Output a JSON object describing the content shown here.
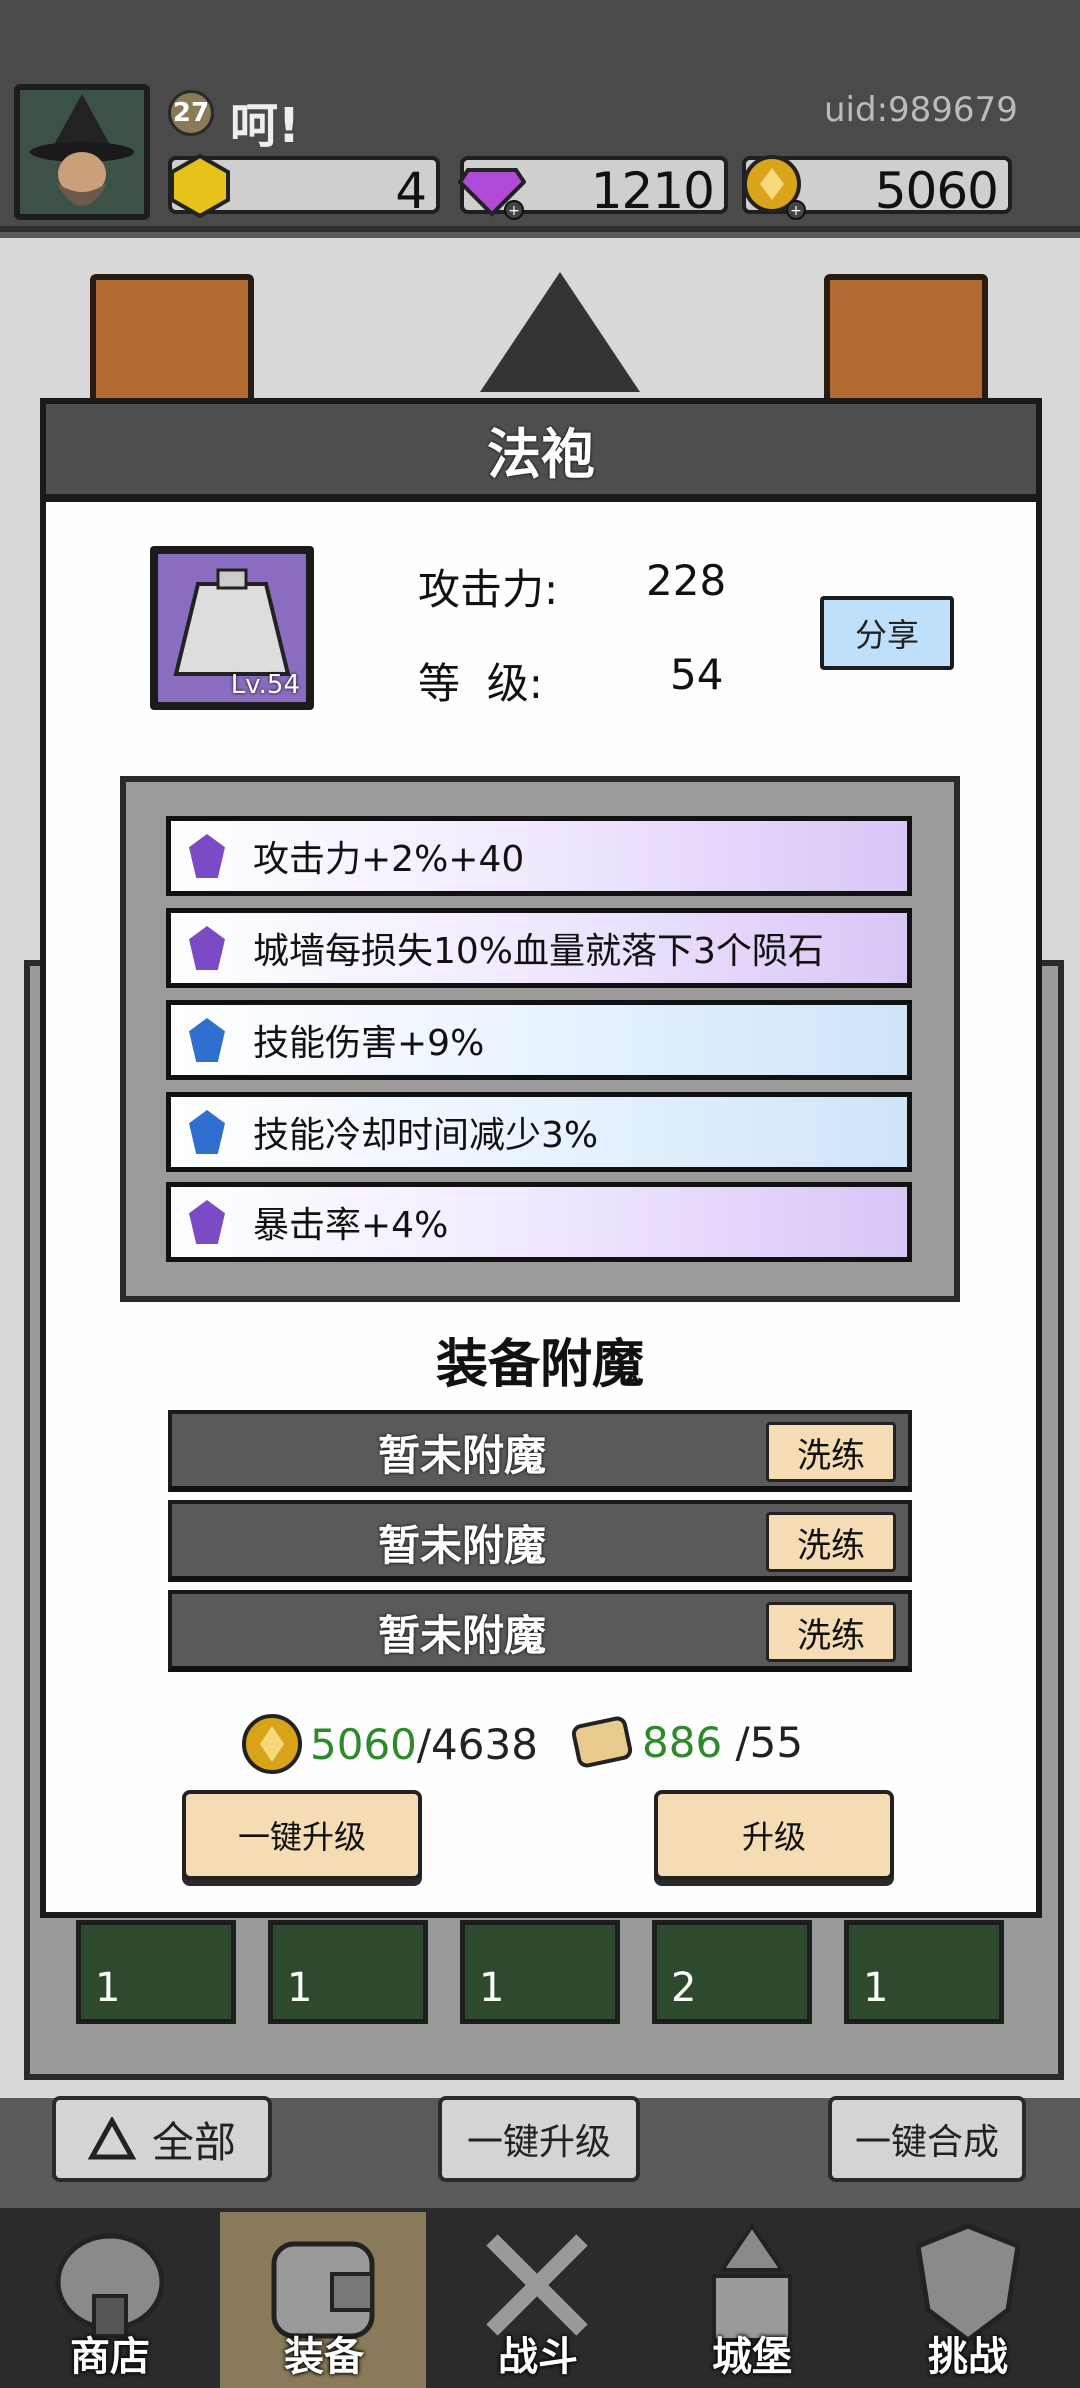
{
  "player": {
    "level": "27",
    "name": "呵!",
    "uid": "uid:989679"
  },
  "resources": [
    {
      "icon": "yellow-gem-icon",
      "value": "4"
    },
    {
      "icon": "purple-diamond-icon",
      "value": "1210"
    },
    {
      "icon": "gold-coin-icon",
      "value": "5060"
    }
  ],
  "background": {
    "material_counts": [
      "1",
      "1",
      "1",
      "2",
      "1"
    ],
    "filter_label": "全部",
    "upgrade_all_label": "一键升级",
    "merge_all_label": "一键合成"
  },
  "nav": [
    {
      "label": "商店",
      "icon": "shop-icon"
    },
    {
      "label": "装备",
      "icon": "backpack-icon"
    },
    {
      "label": "战斗",
      "icon": "crossed-swords-icon"
    },
    {
      "label": "城堡",
      "icon": "castle-icon"
    },
    {
      "label": "挑战",
      "icon": "challenge-shield-icon"
    }
  ],
  "modal": {
    "title": "法袍",
    "item_level": "Lv.54",
    "attack_label": "攻击力:",
    "attack_value": "228",
    "level_label": "等  级:",
    "level_value": "54",
    "share_label": "分享",
    "attributes": [
      {
        "text": "攻击力+2%+40",
        "tier": "purple"
      },
      {
        "text": "城墙每损失10%血量就落下3个陨石",
        "tier": "purple"
      },
      {
        "text": "技能伤害+9%",
        "tier": "blue"
      },
      {
        "text": "技能冷却时间减少3%",
        "tier": "blue"
      },
      {
        "text": "暴击率+4%",
        "tier": "purple"
      }
    ],
    "enchant_title": "装备附魔",
    "enchants": [
      {
        "text": "暂未附魔",
        "button": "洗练"
      },
      {
        "text": "暂未附魔",
        "button": "洗练"
      },
      {
        "text": "暂未附魔",
        "button": "洗练"
      }
    ],
    "gold_have": "5060",
    "gold_need": "/4638",
    "scroll_have": "886",
    "scroll_need": " /55",
    "upgrade_all_label": "一键升级",
    "upgrade_label": "升级"
  },
  "colors": {
    "attr_purple": "#7a4bc4",
    "attr_blue": "#2f6fd0",
    "cost_have": "#2d8a2a",
    "button_beige": "#f5dcb4"
  }
}
